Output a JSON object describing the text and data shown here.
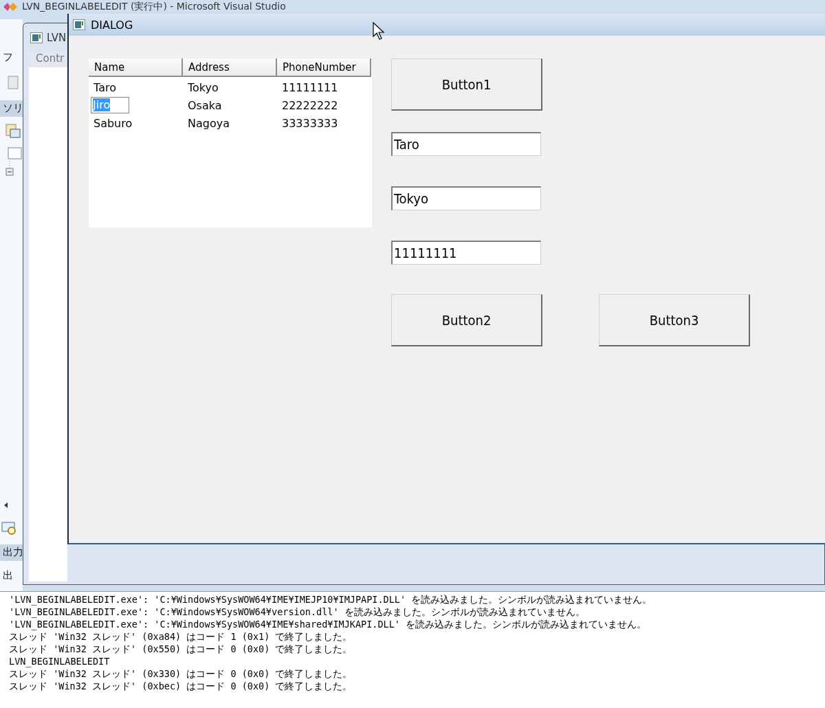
{
  "ide": {
    "title": "LVN_BEGINLABELEDIT (実行中) - Microsoft Visual Studio",
    "menu_label": "フ",
    "child_window_title": "LVN",
    "tab_label": "Contr",
    "panel_label": "ソリ",
    "output_label": "出力",
    "output_label_2": "出"
  },
  "dialog": {
    "title": "DIALOG",
    "list": {
      "columns": [
        "Name",
        "Address",
        "PhoneNumber"
      ],
      "rows": [
        {
          "cells": [
            "Taro",
            "Tokyo",
            "11111111"
          ],
          "editing": false
        },
        {
          "cells": [
            "Jiro",
            "Osaka",
            "22222222"
          ],
          "editing": true
        },
        {
          "cells": [
            "Saburo",
            "Nagoya",
            "33333333"
          ],
          "editing": false
        }
      ]
    },
    "top_button": "Button1",
    "fields": [
      {
        "value": "Taro"
      },
      {
        "value": "Tokyo"
      },
      {
        "value": "11111111"
      }
    ],
    "bottom_buttons": [
      "Button2",
      "Button3"
    ]
  },
  "output": {
    "lines": [
      "'LVN_BEGINLABELEDIT.exe': 'C:¥Windows¥SysWOW64¥IME¥IMEJP10¥IMJPAPI.DLL' を読み込みました。シンボルが読み込まれていません。",
      "'LVN_BEGINLABELEDIT.exe': 'C:¥Windows¥SysWOW64¥version.dll' を読み込みました。シンボルが読み込まれていません。",
      "'LVN_BEGINLABELEDIT.exe': 'C:¥Windows¥SysWOW64¥IME¥shared¥IMJKAPI.DLL' を読み込みました。シンボルが読み込まれていません。",
      "スレッド 'Win32 スレッド' (0xa84) はコード 1 (0x1) で終了しました。",
      "スレッド 'Win32 スレッド' (0x550) はコード 0 (0x0) で終了しました。",
      "LVN_BEGINLABELEDIT",
      "スレッド 'Win32 スレッド' (0x330) はコード 0 (0x0) で終了しました。",
      "スレッド 'Win32 スレッド' (0xbec) はコード 0 (0x0) で終了しました。"
    ]
  }
}
